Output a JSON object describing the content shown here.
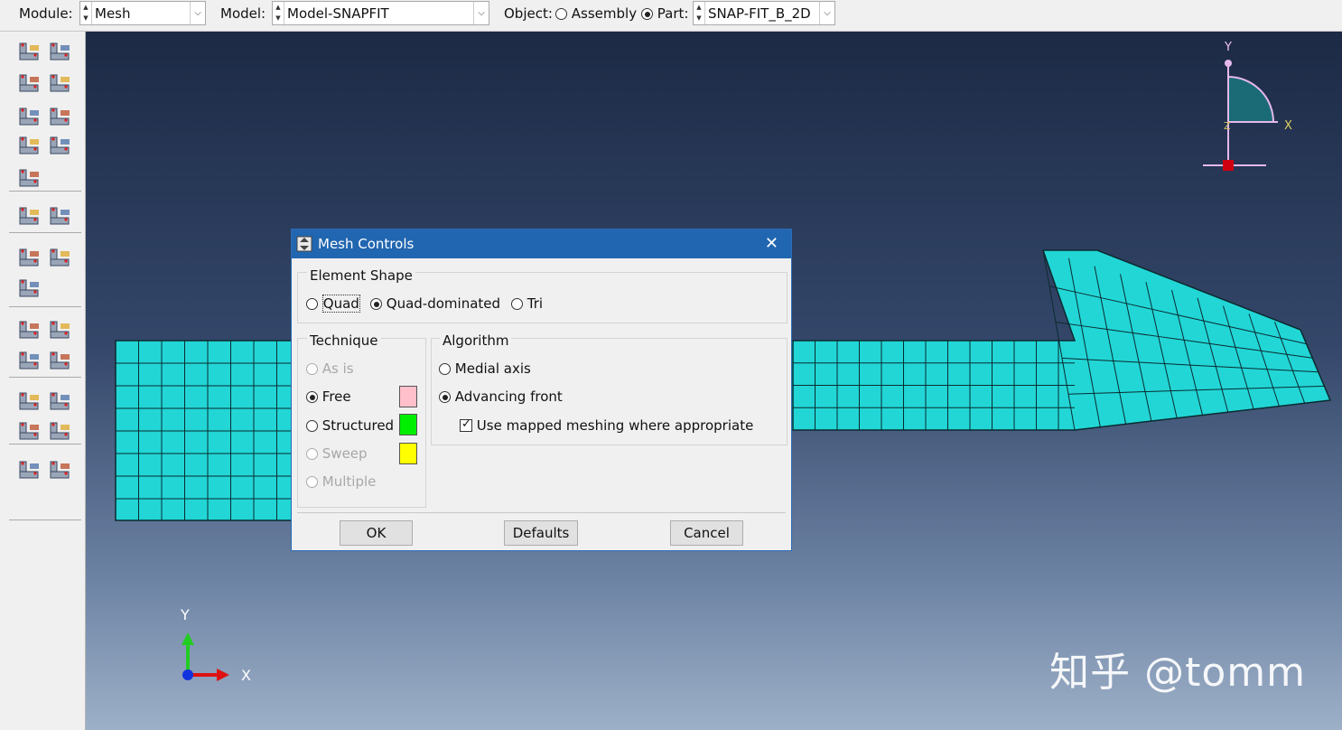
{
  "toolbar": {
    "module_label": "Module:",
    "module_value": "Mesh",
    "model_label": "Model:",
    "model_value": "Model-SNAPFIT",
    "object_label": "Object:",
    "assembly_label": "Assembly",
    "part_label": "Part:",
    "part_value": "SNAP-FIT_B_2D",
    "object_selected": "Part"
  },
  "toolbox": {
    "icons": [
      "seed-part-icon",
      "seed-edge-icon",
      "mesh-part-icon",
      "mesh-region-icon",
      "assign-element-type-icon",
      "verify-mesh-icon",
      "element-type-s4r-icon",
      "check-mesh-icon",
      "mesh-controls-icon",
      "copy-mesh-icon",
      "query-table-icon",
      "delete-seeds-icon",
      "delete-mesh-icon",
      "edit-mesh-icon",
      "partition-select-icon",
      "partition-face-icon",
      "partition-cell-icon",
      "datum-point-icon",
      "datum-axis-icon",
      "datum-plane-icon",
      "virtual-topology-icon",
      "ignore-entities-icon",
      "repair-icon",
      "settings-tools-icon"
    ]
  },
  "viewport": {
    "triad_top": {
      "y": "Y",
      "x": "X",
      "z": "Z"
    },
    "triad_bottom": {
      "y": "Y",
      "x": "X"
    },
    "watermark": "知乎 @tomm",
    "mesh_color": "#22d6d6"
  },
  "dialog": {
    "title": "Mesh Controls",
    "close": "✕",
    "element_shape": {
      "label": "Element Shape",
      "options": [
        "Quad",
        "Quad-dominated",
        "Tri"
      ],
      "selected": "Quad-dominated"
    },
    "technique": {
      "label": "Technique",
      "options": [
        {
          "label": "As is",
          "enabled": false,
          "selected": false
        },
        {
          "label": "Free",
          "enabled": true,
          "selected": true,
          "color": "#ffc0cb"
        },
        {
          "label": "Structured",
          "enabled": true,
          "selected": false,
          "color": "#00ee00"
        },
        {
          "label": "Sweep",
          "enabled": false,
          "selected": false,
          "color": "#ffff00"
        },
        {
          "label": "Multiple",
          "enabled": false,
          "selected": false
        }
      ]
    },
    "algorithm": {
      "label": "Algorithm",
      "options": [
        "Medial axis",
        "Advancing front"
      ],
      "selected": "Advancing front",
      "mapped_meshing": {
        "label": "Use mapped meshing where appropriate",
        "checked": true
      }
    },
    "buttons": {
      "ok": "OK",
      "defaults": "Defaults",
      "cancel": "Cancel"
    }
  }
}
